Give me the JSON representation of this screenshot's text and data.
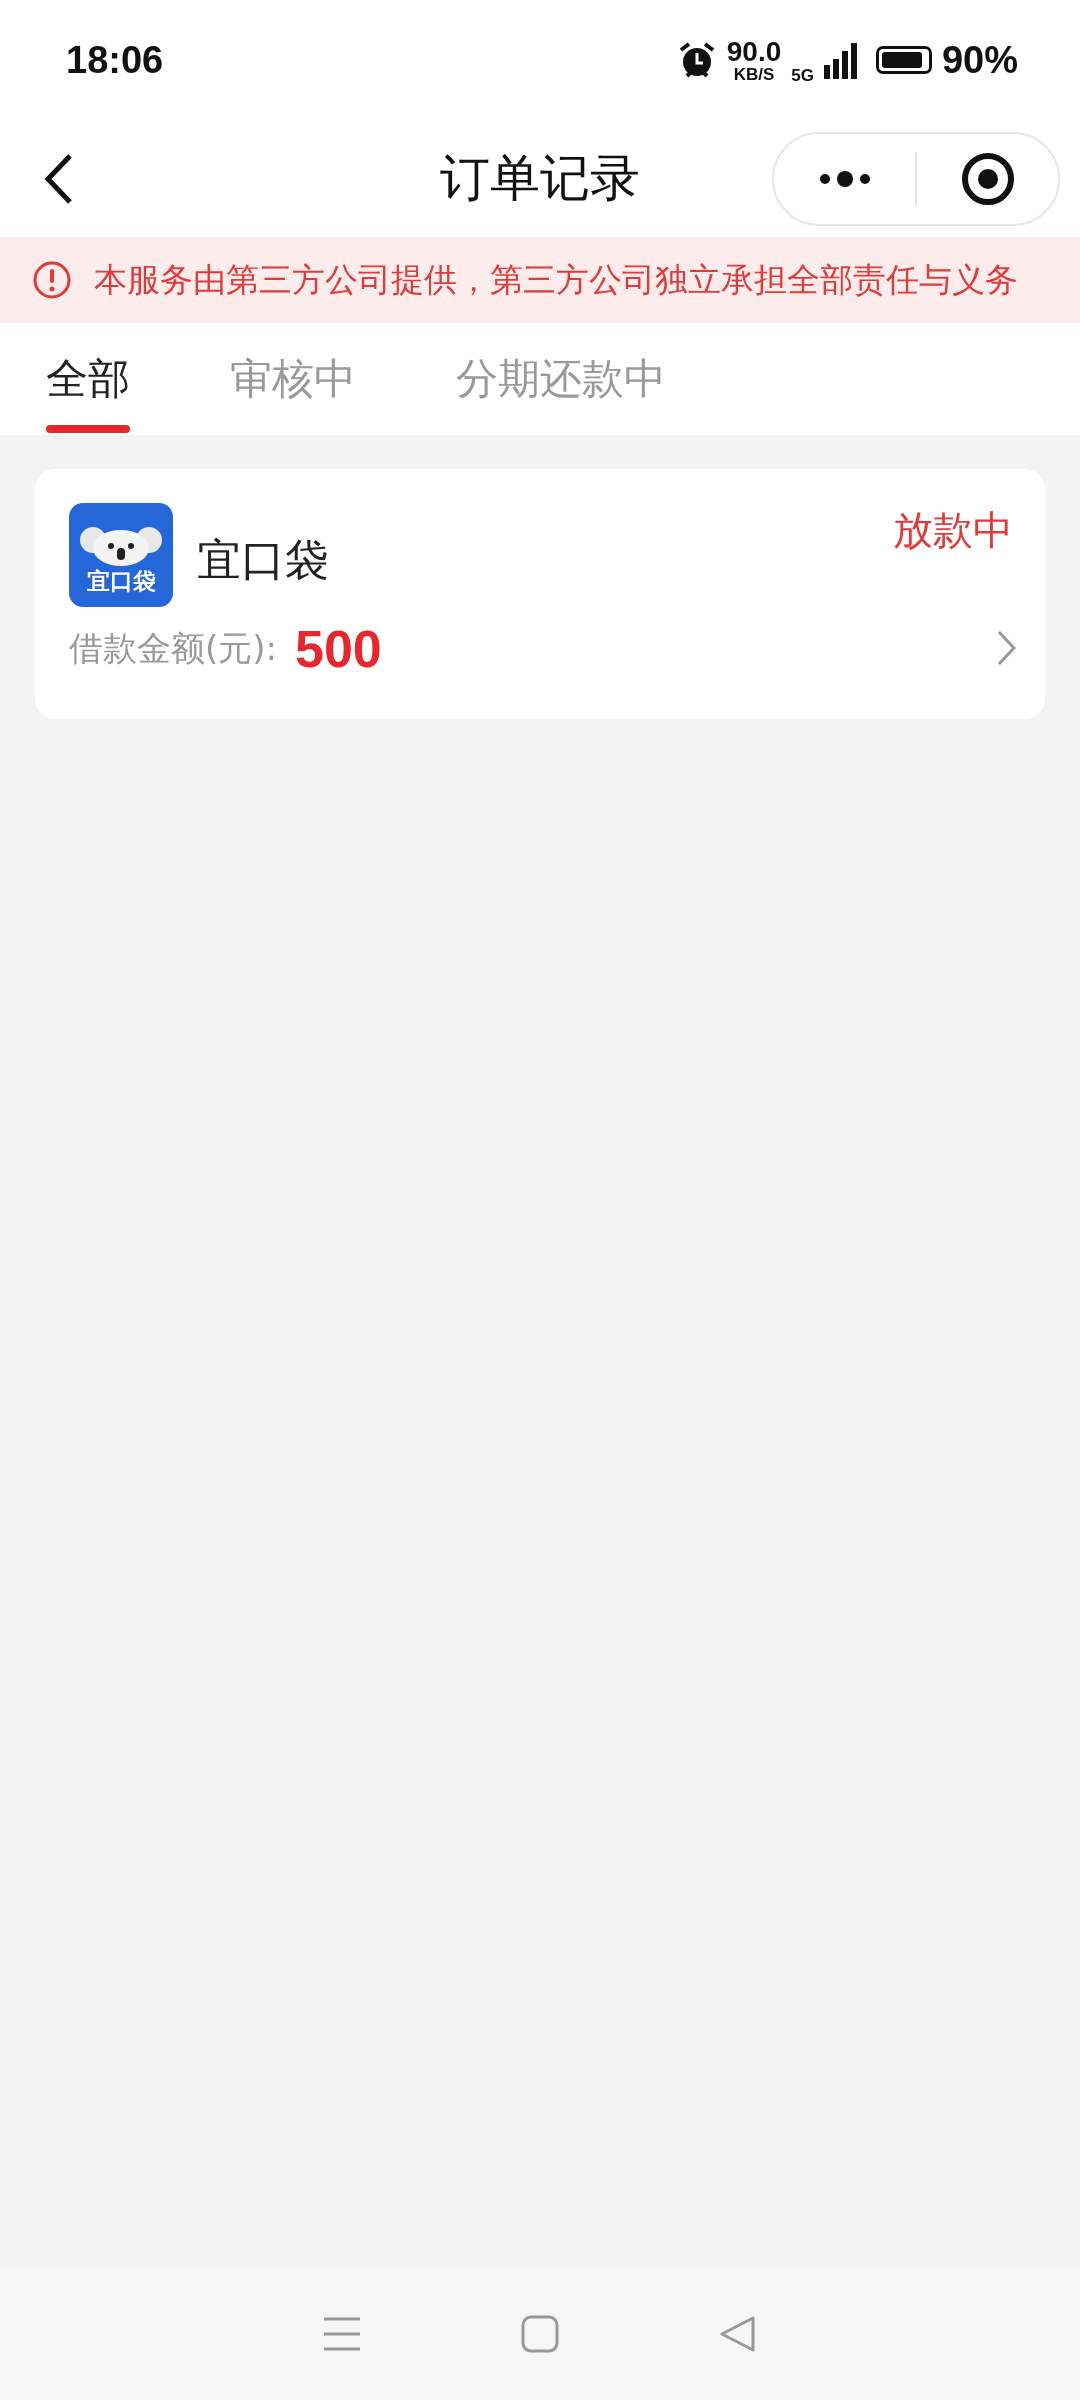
{
  "status_bar": {
    "time": "18:06",
    "net_speed": "90.0",
    "net_unit": "KB/S",
    "network": "5G",
    "battery": "90%"
  },
  "header": {
    "title": "订单记录"
  },
  "notice": {
    "text": "本服务由第三方公司提供，第三方公司独立承担全部责任与义务"
  },
  "tabs": [
    {
      "label": "全部",
      "selected": true
    },
    {
      "label": "审核中",
      "selected": false
    },
    {
      "label": "分期还款中",
      "selected": false
    }
  ],
  "orders": [
    {
      "app_name": "宜口袋",
      "logo_text": "宜口袋",
      "status": "放款中",
      "amount_label": "借款金额(元):",
      "amount": "500"
    }
  ]
}
